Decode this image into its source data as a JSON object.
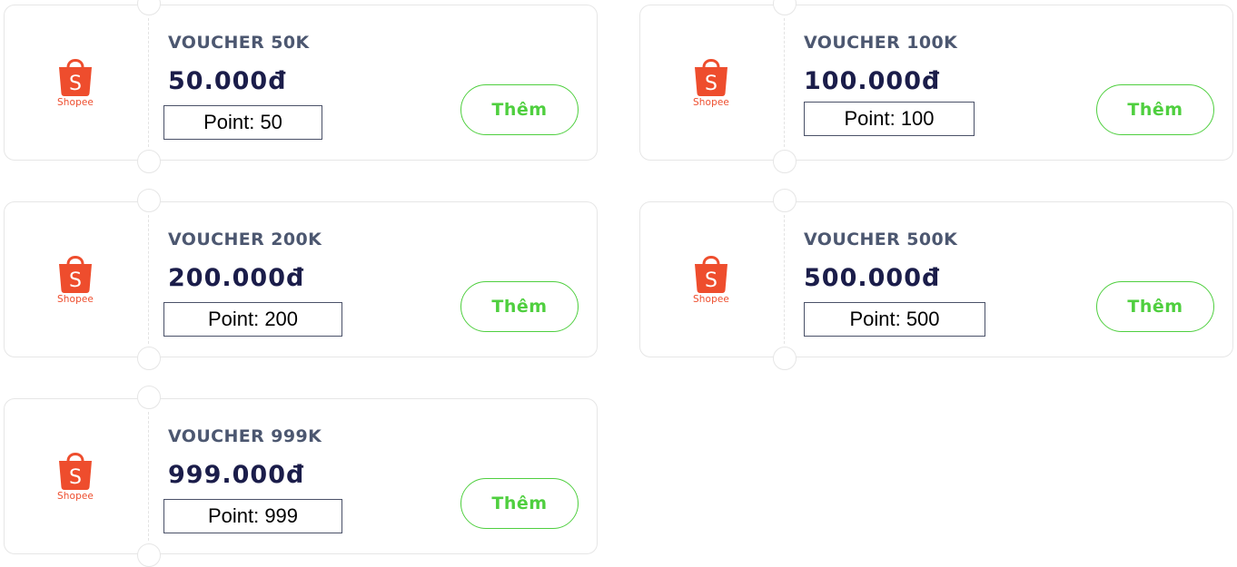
{
  "brand": {
    "name": "Shopee",
    "color": "#ee4d2d"
  },
  "accent_color": "#4fcf3f",
  "vouchers": [
    {
      "title": "VOUCHER 50K",
      "price": "50.000đ",
      "point": "Point: 50",
      "button": "Thêm"
    },
    {
      "title": "VOUCHER 100K",
      "price": "100.000đ",
      "point": "Point: 100",
      "button": "Thêm"
    },
    {
      "title": "VOUCHER 200K",
      "price": "200.000đ",
      "point": "Point: 200",
      "button": "Thêm"
    },
    {
      "title": "VOUCHER 500K",
      "price": "500.000đ",
      "point": "Point: 500",
      "button": "Thêm"
    },
    {
      "title": "VOUCHER 999K",
      "price": "999.000đ",
      "point": "Point: 999",
      "button": "Thêm"
    }
  ]
}
